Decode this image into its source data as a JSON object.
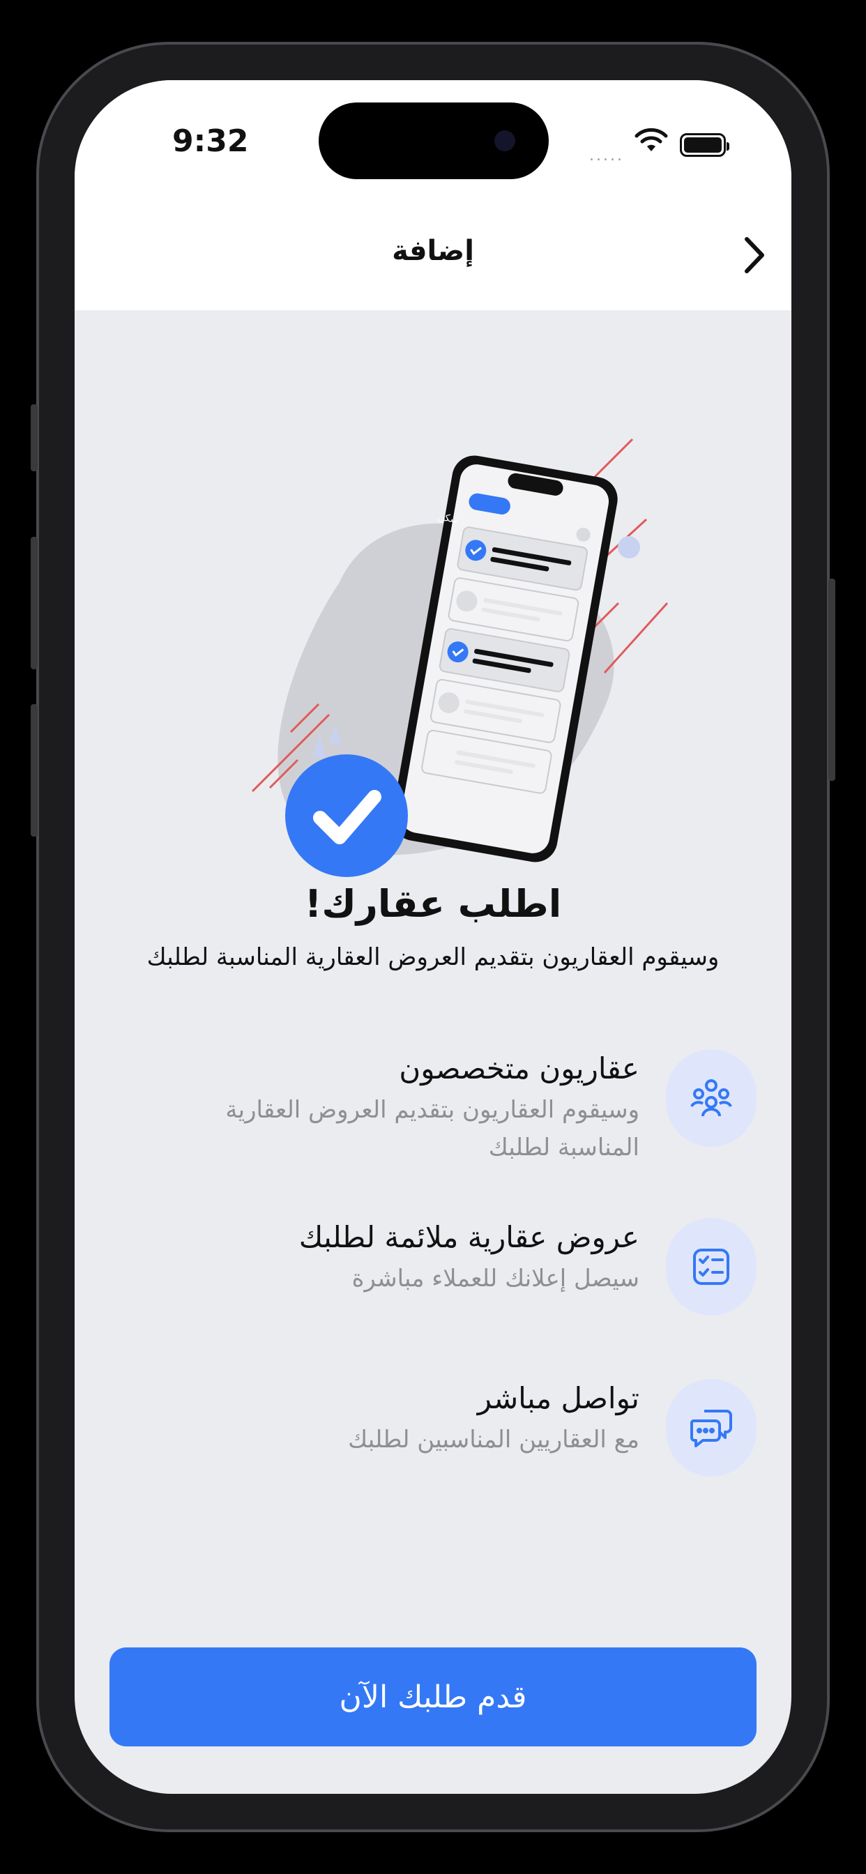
{
  "status_bar": {
    "time": "9:32",
    "signal": "....."
  },
  "header": {
    "title": "إضافة"
  },
  "illustration": {
    "app_badge": "سكن"
  },
  "hero": {
    "title": "اطلب عقارك!",
    "subtitle": "وسيقوم العقاريون بتقديم العروض العقارية المناسبة لطلبك"
  },
  "features": [
    {
      "title": "عقاريون متخصصون",
      "desc": "وسيقوم العقاريون بتقديم العروض العقارية المناسبة لطلبك",
      "icon": "people-group-icon"
    },
    {
      "title": "عروض عقارية ملائمة لطلبك",
      "desc": "سيصل إعلانك للعملاء مباشرة",
      "icon": "checklist-icon"
    },
    {
      "title": "تواصل مباشر",
      "desc": "مع العقاريين المناسبين لطلبك",
      "icon": "chat-bubbles-icon"
    }
  ],
  "cta": {
    "label": "قدم طلبك الآن"
  },
  "colors": {
    "accent": "#3478f6",
    "icon_bg": "#dfe6fb",
    "background": "#ebecf0",
    "decor_line": "#e05a5a"
  }
}
